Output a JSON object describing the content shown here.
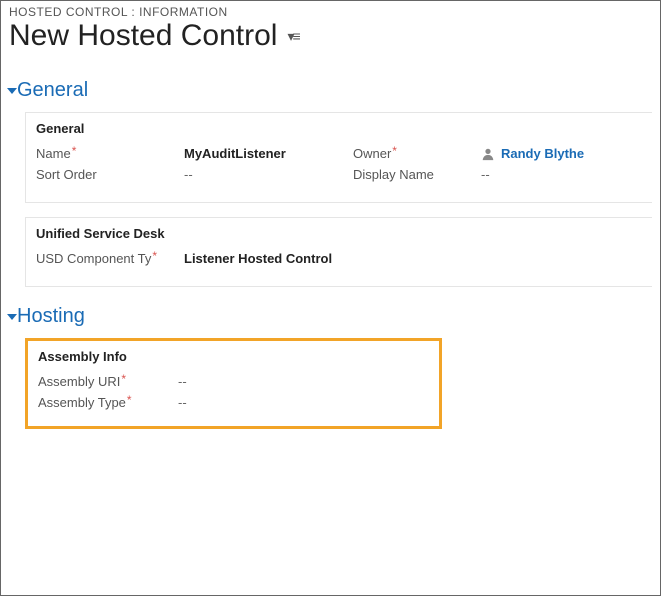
{
  "breadcrumb": "HOSTED CONTROL : INFORMATION",
  "pageTitle": "New Hosted Control",
  "sections": {
    "general": {
      "title": "General",
      "panels": {
        "general": {
          "title": "General",
          "fields": {
            "nameLabel": "Name",
            "nameValue": "MyAuditListener",
            "ownerLabel": "Owner",
            "ownerName": "Randy Blythe",
            "sortOrderLabel": "Sort Order",
            "sortOrderValue": "--",
            "displayNameLabel": "Display Name",
            "displayNameValue": "--"
          }
        },
        "usd": {
          "title": "Unified Service Desk",
          "fields": {
            "componentTypeLabel": "USD Component Ty",
            "componentTypeValue": "Listener Hosted Control"
          }
        }
      }
    },
    "hosting": {
      "title": "Hosting",
      "panel": {
        "title": "Assembly Info",
        "fields": {
          "assemblyUriLabel": "Assembly URI",
          "assemblyUriValue": "--",
          "assemblyTypeLabel": "Assembly Type",
          "assemblyTypeValue": "--"
        }
      }
    }
  }
}
